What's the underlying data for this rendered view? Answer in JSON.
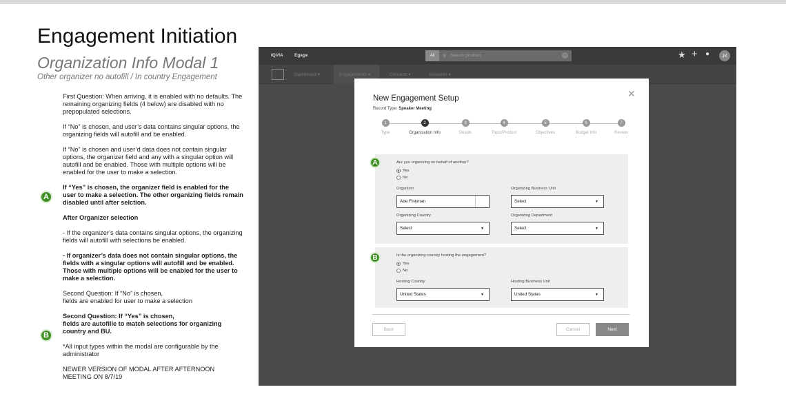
{
  "page": {
    "title": "Engagement Initiation",
    "subtitle": "Organization Info Modal 1",
    "subtitle2": "Other organizer no autofill / In country Engagement"
  },
  "notes": {
    "p1": "First Question: When arriving, it is enabled with no defaults. The remaining organizing fields (4 below) are disabled with no prepopulated selections.",
    "p2": "If “No” is chosen, and user’s data contains singular options, the organizing fields will autofill and be enabled.",
    "p3": "If “No” is chosen and user’d data does not contain singular options, the organizer field and any with a singular option will autofill and be enabled.  Those with multiple options will be enabled for the user to make a selection.",
    "p4": "If “Yes” is chosen, the organizer field is enabled for the user to make a selection.  The other organizing fields remain disabled until after selction.",
    "p5": "After Organizer selection",
    "p6": "- If the organizer’s data contains singular options, the organizing fields will autofill with selections be enabled.",
    "p7": "- If organizer’s data does not contain singular options, the fields with a singular options will autofill and be enabled. Those with multiple options will be enabled for the user to make a selection.",
    "p8a": "Second Question: If “No” is chosen,",
    "p8b": "fields are enabled for user to make a selection",
    "p9a": "Second Question: If “Yes” is chosen,",
    "p9b": "fields are autofille to match selections for organizing country and BU.",
    "p10": "*All input types within the modal are configurable by the administrator",
    "p11": "NEWER VERSION OF MODAL AFTER AFTERNOON MEETING ON 8/7/19",
    "badge_a": "A",
    "badge_b": "B"
  },
  "app": {
    "brand1": "IQVIA",
    "brand2": "Egage",
    "search_scope": "All",
    "search_placeholder": "Search product",
    "avatar": "JK",
    "nav": [
      "Dashboard ▾",
      "Engagements ▾",
      "Contacts ▾",
      "Accounts ▾"
    ]
  },
  "modal": {
    "title": "New Engagement Setup",
    "record_type_label": "Record Type:",
    "record_type_value": "Speaker Meeting",
    "steps": [
      {
        "num": "1",
        "label": "Type"
      },
      {
        "num": "2",
        "label": "Organization Info"
      },
      {
        "num": "3",
        "label": "Details"
      },
      {
        "num": "4",
        "label": "Topic/Product"
      },
      {
        "num": "5",
        "label": "Objectives"
      },
      {
        "num": "6",
        "label": "Budget Info"
      },
      {
        "num": "7",
        "label": "Review"
      }
    ],
    "section_a": {
      "badge": "A",
      "question": "Are you organizing on behalf of another?",
      "yes": "Yes",
      "no": "No",
      "organizer_label": "Organizer",
      "organizer_value": "Abe Finkman",
      "obu_label": "Organizing Business Unit",
      "obu_value": "Select",
      "country_label": "Organizing Country",
      "country_value": "Select",
      "dept_label": "Organizing Department",
      "dept_value": "Select"
    },
    "section_b": {
      "badge": "B",
      "question": "Is the organizing country hosting the engagement?",
      "yes": "Yes",
      "no": "No",
      "hc_label": "Hosting Country",
      "hc_value": "United States",
      "hbu_label": "Hosting Business Unit",
      "hbu_value": "United States"
    },
    "back": "Back",
    "cancel": "Cancel",
    "next": "Next"
  }
}
